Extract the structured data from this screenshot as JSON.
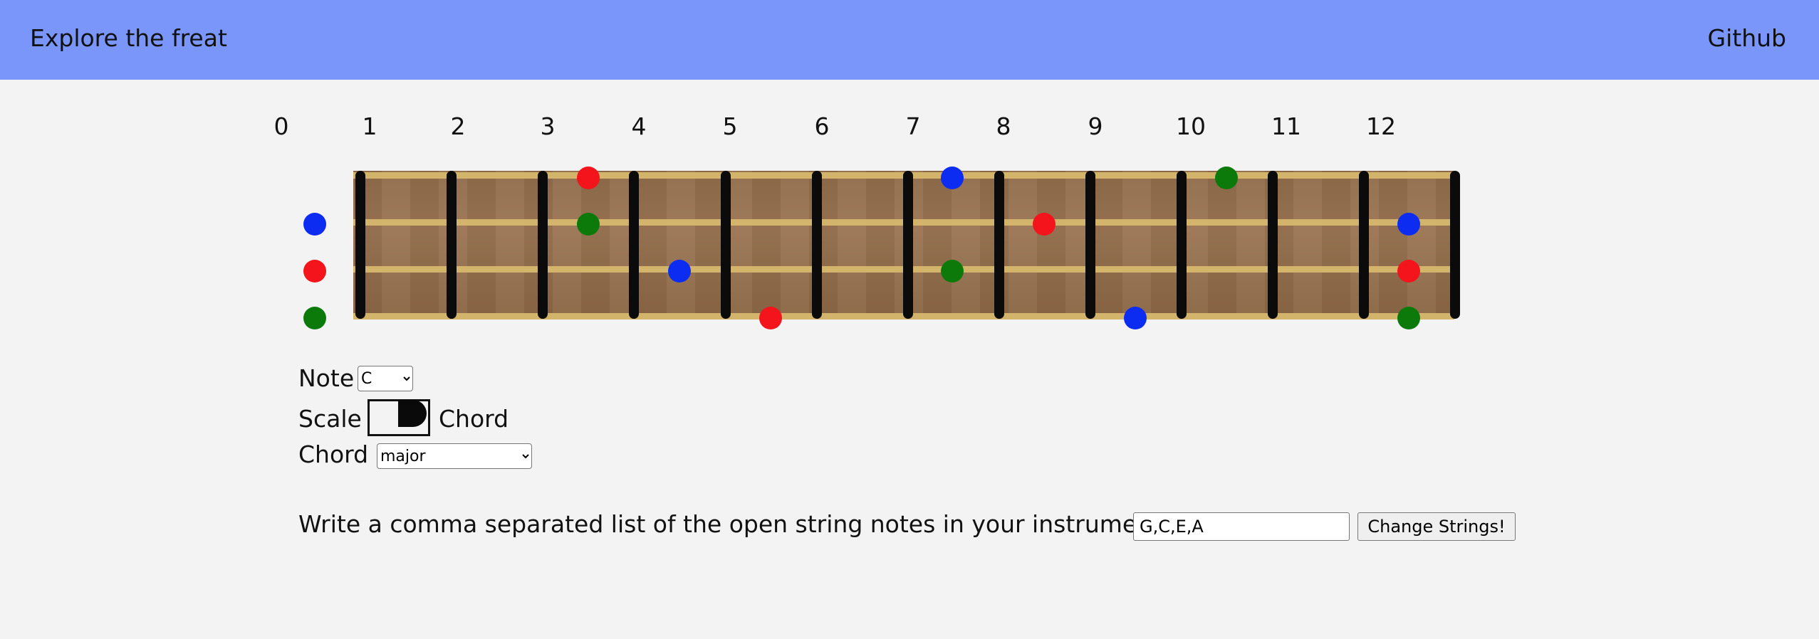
{
  "header": {
    "title": "Explore the freat",
    "github_label": "Github"
  },
  "fret_numbers": [
    "0",
    "1",
    "2",
    "3",
    "4",
    "5",
    "6",
    "7",
    "8",
    "9",
    "10",
    "11",
    "12"
  ],
  "colors": {
    "root": "#f3141c",
    "third": "#0d2cf2",
    "fifth": "#0b7a0b",
    "header_bg": "#7b96fb"
  },
  "controls": {
    "note_label": "Note",
    "note_value": "C",
    "note_options": [
      "C"
    ],
    "scale_label": "Scale",
    "chord_toggle_label": "Chord",
    "chord_label": "Chord",
    "chord_value": "major",
    "chord_options": [
      "major"
    ]
  },
  "strings": {
    "prompt": "Write a comma separated list of the open string notes in your instrument",
    "value": "G,C,E,A",
    "button_label": "Change Strings!"
  }
}
